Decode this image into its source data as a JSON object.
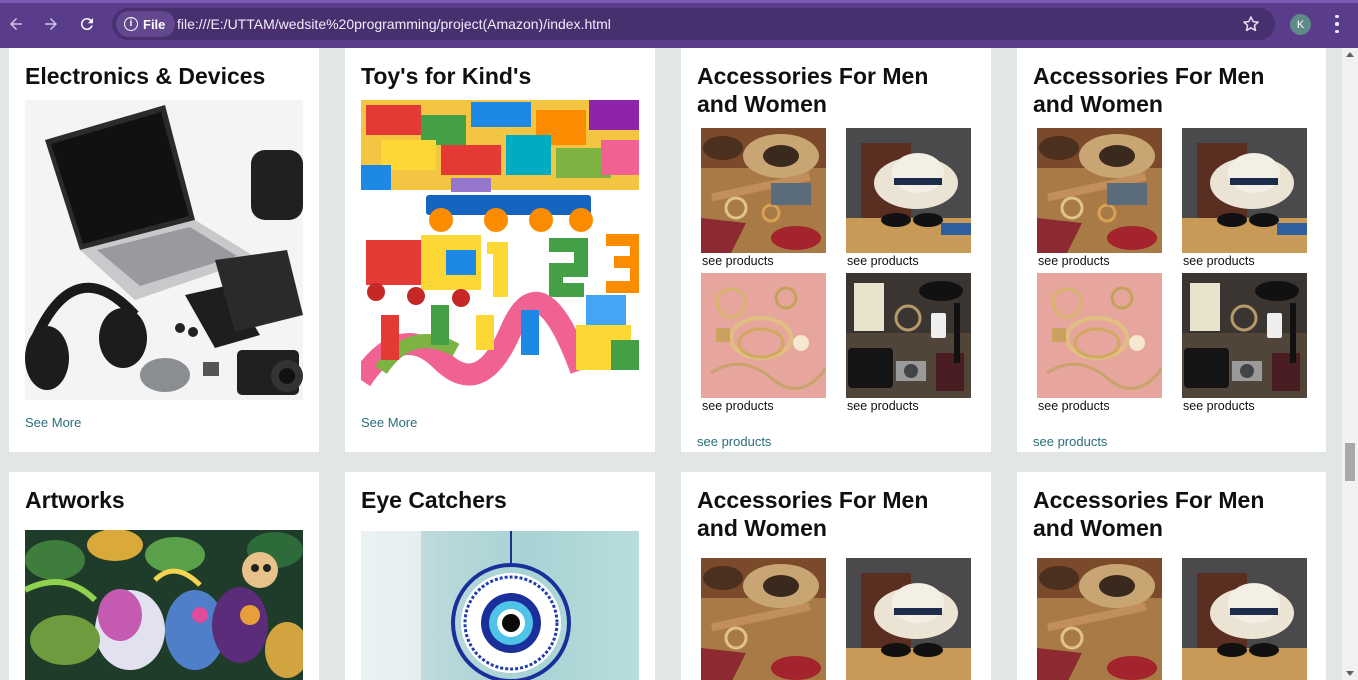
{
  "browser": {
    "back_icon": "arrow-left-icon",
    "forward_icon": "arrow-right-icon",
    "reload_icon": "reload-icon",
    "scheme_chip": "File",
    "url": "file:///E:/UTTAM/wedsite%20programming/project(Amazon)/index.html",
    "profile_initial": "K"
  },
  "row1": [
    {
      "title": "Electronics & Devices",
      "link": "See More"
    },
    {
      "title": "Toy's for Kind's",
      "link": "See More"
    },
    {
      "title": "Accessories For Men and Women",
      "tiles": [
        "see products",
        "see products",
        "see products",
        "see products"
      ],
      "link": "see products"
    },
    {
      "title": "Accessories For Men and Women",
      "tiles": [
        "see products",
        "see products",
        "see products",
        "see products"
      ],
      "link": "see products"
    }
  ],
  "row2": [
    {
      "title": "Artworks"
    },
    {
      "title": "Eye Catchers"
    },
    {
      "title": "Accessories For Men and Women"
    },
    {
      "title": "Accessories For Men and Women"
    }
  ],
  "colors": {
    "page_background": "#e3e6e6",
    "link": "#2a6f7c",
    "chrome": "#5a3d8a"
  }
}
